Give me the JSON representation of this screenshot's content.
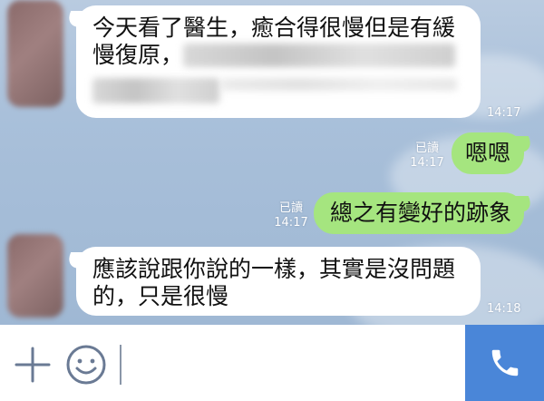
{
  "messages": [
    {
      "direction": "incoming",
      "text_line1": "今天看了醫生，癒合得很慢但是有緩",
      "text_line2": "慢復原，",
      "blurred_region": true,
      "time": "14:17"
    },
    {
      "direction": "outgoing",
      "text": "嗯嗯",
      "read": "已讀",
      "time": "14:17"
    },
    {
      "direction": "outgoing",
      "text": "總之有變好的跡象",
      "read": "已讀",
      "time": "14:17"
    },
    {
      "direction": "incoming",
      "text_line1": "應該說跟你說的一樣，其實是沒問題",
      "text_line2": "的，只是很慢",
      "time": "14:18"
    }
  ],
  "input_bar": {
    "add_icon": "plus-icon",
    "emoji_icon": "smiley-icon",
    "call_icon": "phone-icon",
    "accent_color": "#4a86d8"
  },
  "colors": {
    "incoming_bubble": "#ffffff",
    "outgoing_bubble": "#a5e57f",
    "background": "#a9c0da"
  }
}
